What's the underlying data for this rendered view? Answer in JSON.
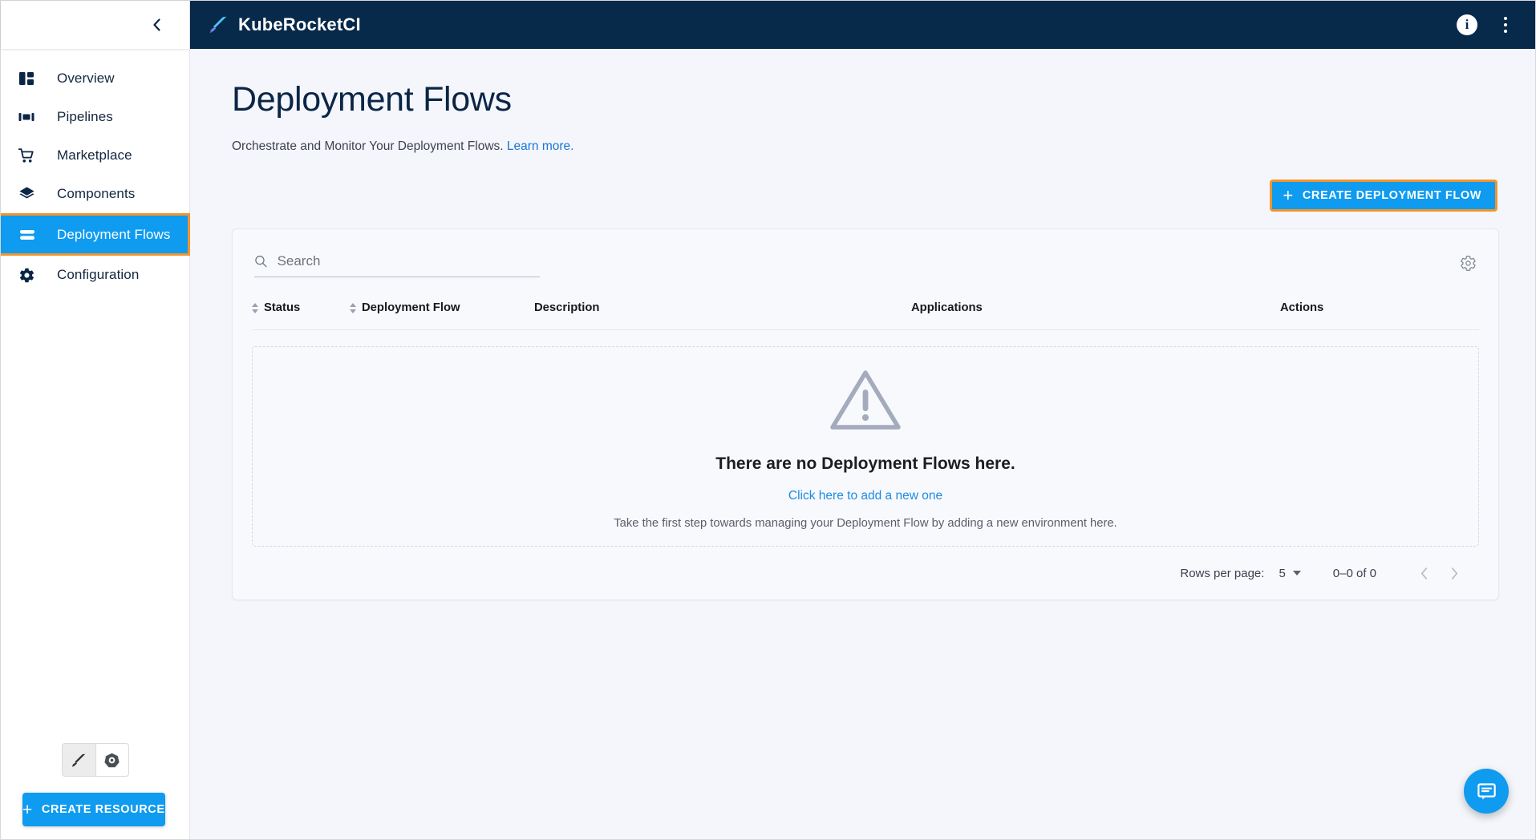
{
  "theme": {
    "accent": "#0e9bf0",
    "topbar_bg": "#07294a",
    "highlight_border": "#f2952c",
    "page_bg": "#f4f6fb",
    "link": "#1b8ce3"
  },
  "sidebar": {
    "collapse_icon": "chevron-left-icon",
    "items": [
      {
        "label": "Overview",
        "icon": "dashboard-icon",
        "active": false
      },
      {
        "label": "Pipelines",
        "icon": "pipelines-icon",
        "active": false
      },
      {
        "label": "Marketplace",
        "icon": "shopping-cart-icon",
        "active": false
      },
      {
        "label": "Components",
        "icon": "layers-icon",
        "active": false
      },
      {
        "label": "Deployment Flows",
        "icon": "deployment-flows-icon",
        "active": true
      },
      {
        "label": "Configuration",
        "icon": "gear-icon",
        "active": false
      }
    ],
    "footer": {
      "toggle_buttons": [
        {
          "icon": "kuberocket-sword-icon",
          "selected": true
        },
        {
          "icon": "kubernetes-icon",
          "selected": false
        }
      ],
      "create_resource_label": "CREATE RESOURCE",
      "create_resource_plus": "+"
    }
  },
  "topbar": {
    "brand_icon": "kuberocket-sword-icon",
    "brand_title": "KubeRocketCI",
    "info_icon": "info-icon",
    "info_glyph": "i",
    "kebab_icon": "more-vertical-icon"
  },
  "page": {
    "title": "Deployment Flows",
    "subtitle_text": "Orchestrate and Monitor Your Deployment Flows.",
    "subtitle_link": "Learn more.",
    "create_button_label": "CREATE DEPLOYMENT FLOW",
    "create_button_plus": "+"
  },
  "table": {
    "search": {
      "placeholder": "Search",
      "value": "",
      "icon": "search-icon"
    },
    "settings_icon": "gear-icon",
    "columns": [
      {
        "label": "Status",
        "sortable": true,
        "align": "left"
      },
      {
        "label": "Deployment Flow",
        "sortable": true,
        "align": "left"
      },
      {
        "label": "Description",
        "sortable": false,
        "align": "left"
      },
      {
        "label": "Applications",
        "sortable": false,
        "align": "left"
      },
      {
        "label": "Actions",
        "sortable": false,
        "align": "right"
      }
    ],
    "rows": [],
    "empty_state": {
      "icon": "warning-triangle-icon",
      "title": "There are no Deployment Flows here.",
      "link": "Click here to add a new one",
      "hint": "Take the first step towards managing your Deployment Flow by adding a new environment here."
    },
    "pagination": {
      "rows_per_page_label": "Rows per page:",
      "rows_per_page_value": "5",
      "range_label": "0–0 of 0",
      "prev_icon": "chevron-left-icon",
      "next_icon": "chevron-right-icon"
    }
  },
  "fab": {
    "icon": "chat-message-icon"
  }
}
